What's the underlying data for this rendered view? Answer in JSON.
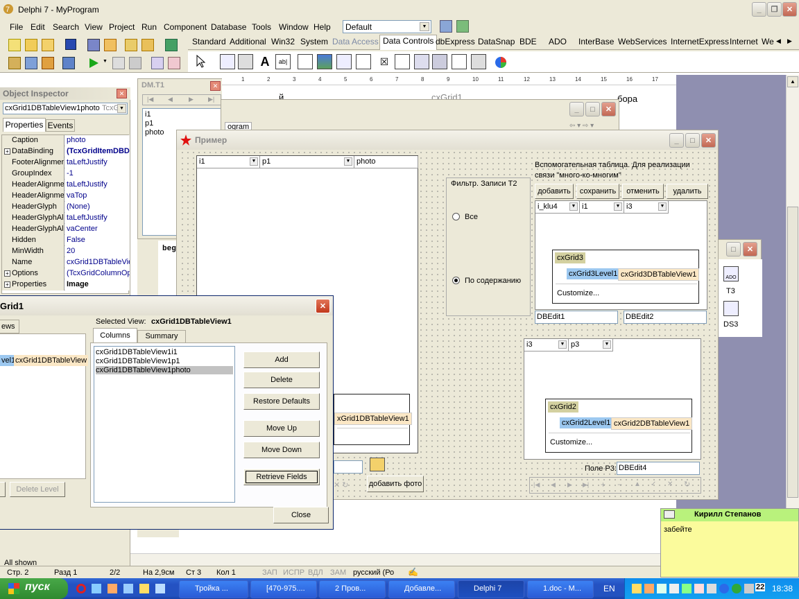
{
  "app": {
    "title": "Delphi 7 - MyProgram"
  },
  "menu": [
    "File",
    "Edit",
    "Search",
    "View",
    "Project",
    "Run",
    "Component",
    "Database",
    "Tools",
    "Window",
    "Help"
  ],
  "desktop_combo": "Default",
  "palette_tabs": [
    "Standard",
    "Additional",
    "Win32",
    "System",
    "Data Access",
    "Data Controls",
    "dbExpress",
    "DataSnap",
    "BDE",
    "ADO",
    "InterBase",
    "WebServices",
    "InternetExpress",
    "Internet",
    "We"
  ],
  "object_inspector": {
    "title": "Object Inspector",
    "selector": "cxGrid1DBTableView1photo",
    "selector_type": "TcxG",
    "tabs": [
      "Properties",
      "Events"
    ],
    "rows": [
      {
        "name": "Caption",
        "value": "photo",
        "plus": false,
        "bold": false
      },
      {
        "name": "DataBinding",
        "value": "(TcxGridItemDBD",
        "plus": true,
        "bold": true
      },
      {
        "name": "FooterAlignmen",
        "value": "taLeftJustify",
        "plus": false,
        "bold": false
      },
      {
        "name": "GroupIndex",
        "value": "-1",
        "plus": false,
        "bold": false
      },
      {
        "name": "HeaderAlignme",
        "value": "taLeftJustify",
        "plus": false,
        "bold": false
      },
      {
        "name": "HeaderAlignme",
        "value": "vaTop",
        "plus": false,
        "bold": false
      },
      {
        "name": "HeaderGlyph",
        "value": "(None)",
        "plus": false,
        "bold": false
      },
      {
        "name": "HeaderGlyphAl",
        "value": "taLeftJustify",
        "plus": false,
        "bold": false
      },
      {
        "name": "HeaderGlyphAl",
        "value": "vaCenter",
        "plus": false,
        "bold": false
      },
      {
        "name": "Hidden",
        "value": "False",
        "plus": false,
        "bold": false
      },
      {
        "name": "MinWidth",
        "value": "20",
        "plus": false,
        "bold": false
      },
      {
        "name": "Name",
        "value": "cxGrid1DBTableVie",
        "plus": false,
        "bold": false
      },
      {
        "name": "Options",
        "value": "(TcxGridColumnOpt",
        "plus": true,
        "bold": false
      },
      {
        "name": "Properties",
        "value": "Image",
        "plus": true,
        "bold": true
      }
    ],
    "status": "All shown"
  },
  "dm": {
    "title": "DM.T1",
    "fields": [
      "i1",
      "p1",
      "photo"
    ]
  },
  "editor_bg": {
    "code_snippet": "beg",
    "top_left_text": "й",
    "top_mid_text": "cxGrid1",
    "top_right_text": "бора",
    "tab_label": "ogram"
  },
  "ruler": {
    "marks": [
      "1",
      "2",
      "3",
      "4",
      "5",
      "6",
      "7",
      "8",
      "9",
      "10",
      "11",
      "12",
      "13",
      "14",
      "15",
      "16",
      "17"
    ]
  },
  "form": {
    "title": "Пример",
    "grid1_cols": [
      "i1",
      "p1",
      "photo"
    ],
    "filter": {
      "label": "Фильтр. Записи T2",
      "opt_all": "Все",
      "opt_content": "По содержанию"
    },
    "aux": {
      "label_line1": "Вспомогательная таблица. Для реализации",
      "label_line2": "связи \"много-ко-многим\"",
      "buttons": [
        "добавить",
        "сохранить",
        "отменить",
        "удалить"
      ],
      "cols": [
        "i_klu4",
        "i1",
        "i3"
      ]
    },
    "grid3": {
      "caption": "cxGrid3",
      "level": "cxGrid3Level1",
      "view": "cxGrid3DBTableView1",
      "customize": "Customize..."
    },
    "dbedit1": "DBEdit1",
    "dbedit2": "DBEdit2",
    "grid2_cols": [
      "i3",
      "p3"
    ],
    "grid2": {
      "caption": "cxGrid2",
      "level": "cxGrid2Level1",
      "view": "cxGrid2DBTableView1",
      "customize": "Customize..."
    },
    "p3_label": "Поле P3:",
    "dbedit4": "DBEdit4",
    "add_photo": "добавить фото",
    "grid1_view": "xGrid1DBTableView1"
  },
  "dm_right": {
    "t3": "T3",
    "ds3": "DS3"
  },
  "grid_editor": {
    "title": "Grid1",
    "views_tab": "ews",
    "level_text": "vel1",
    "view_text": "cxGrid1DBTableView",
    "delete_level": "Delete Level",
    "selected_view_label": "Selected View:",
    "selected_view": "cxGrid1DBTableView1",
    "tabs": [
      "Columns",
      "Summary"
    ],
    "columns": [
      "cxGrid1DBTableView1i1",
      "cxGrid1DBTableView1p1",
      "cxGrid1DBTableView1photo"
    ],
    "buttons": [
      "Add",
      "Delete",
      "Restore Defaults",
      "Move Up",
      "Move Down",
      "Retrieve Fields"
    ],
    "close": "Close"
  },
  "statusbar": {
    "pos": "Стр. 2",
    "section": "Разд 1",
    "pages": "2/2",
    "at": "На 2,9см",
    "line": "Ст 3",
    "col": "Кол 1",
    "rec": "ЗАП",
    "trk": "ИСПР",
    "ext": "ВДЛ",
    "ovr": "ЗАМ",
    "lang": "русский (Ро"
  },
  "message": {
    "name": "Кирилл Степанов",
    "text": "забейте"
  },
  "taskbar": {
    "start": "пуск",
    "tasks": [
      "Тройка ...",
      "[470-975....",
      "2 Пров...",
      "Добавле...",
      "Delphi 7",
      "1.doc - M..."
    ],
    "lang": "EN",
    "clock": "18:38",
    "tray_num": "22"
  },
  "colors": {
    "xp_blue": "#245edb",
    "xp_green": "#3c9a3c",
    "dialog_bg": "#ece9d8"
  }
}
